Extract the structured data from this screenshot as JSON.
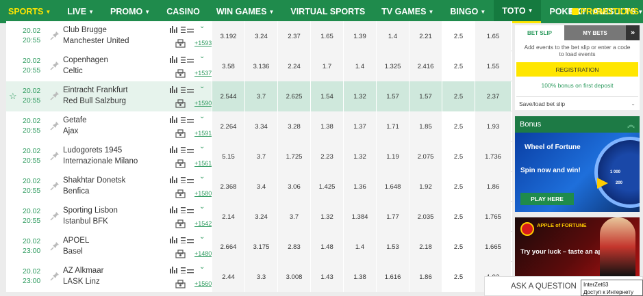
{
  "nav": {
    "items": [
      {
        "label": "SPORTS",
        "caret": true
      },
      {
        "label": "LIVE",
        "caret": true
      },
      {
        "label": "PROMO",
        "caret": true
      },
      {
        "label": "CASINO",
        "caret": false
      },
      {
        "label": "WIN GAMES",
        "caret": true
      },
      {
        "label": "VIRTUAL SPORTS",
        "caret": false
      },
      {
        "label": "TV GAMES",
        "caret": true
      },
      {
        "label": "BINGO",
        "caret": true
      },
      {
        "label": "TOTO",
        "caret": true
      },
      {
        "label": "POKER",
        "caret": false
      },
      {
        "label": "RESULTS",
        "caret": true
      }
    ],
    "extra": "EXTRA",
    "promotions": "PROMOTIONS"
  },
  "events": [
    {
      "date": "20.02",
      "time": "20:55",
      "home": "Club Brugge",
      "away": "Manchester United",
      "more": "+1593",
      "odds": [
        "3.192",
        "3.24",
        "2.37",
        "1.65",
        "1.39",
        "1.4",
        "2.21",
        "2.5",
        "1.65"
      ]
    },
    {
      "date": "20.02",
      "time": "20:55",
      "home": "Copenhagen",
      "away": "Celtic",
      "more": "+1537",
      "odds": [
        "3.58",
        "3.136",
        "2.24",
        "1.7",
        "1.4",
        "1.325",
        "2.416",
        "2.5",
        "1.55"
      ]
    },
    {
      "date": "20.02",
      "time": "20:55",
      "home": "Eintracht Frankfurt",
      "away": "Red Bull Salzburg",
      "more": "+1590",
      "odds": [
        "2.544",
        "3.7",
        "2.625",
        "1.54",
        "1.32",
        "1.57",
        "1.57",
        "2.5",
        "2.37"
      ],
      "highlight": true
    },
    {
      "date": "20.02",
      "time": "20:55",
      "home": "Getafe",
      "away": "Ajax",
      "more": "+1591",
      "odds": [
        "2.264",
        "3.34",
        "3.28",
        "1.38",
        "1.37",
        "1.71",
        "1.85",
        "2.5",
        "1.93"
      ]
    },
    {
      "date": "20.02",
      "time": "20:55",
      "home": "Ludogorets 1945",
      "away": "Internazionale Milano",
      "more": "+1561",
      "odds": [
        "5.15",
        "3.7",
        "1.725",
        "2.23",
        "1.32",
        "1.19",
        "2.075",
        "2.5",
        "1.736"
      ]
    },
    {
      "date": "20.02",
      "time": "20:55",
      "home": "Shakhtar Donetsk",
      "away": "Benfica",
      "more": "+1580",
      "odds": [
        "2.368",
        "3.4",
        "3.06",
        "1.425",
        "1.36",
        "1.648",
        "1.92",
        "2.5",
        "1.86"
      ]
    },
    {
      "date": "20.02",
      "time": "20:55",
      "home": "Sporting Lisbon",
      "away": "Istanbul BFK",
      "more": "+1542",
      "odds": [
        "2.14",
        "3.24",
        "3.7",
        "1.32",
        "1.384",
        "1.77",
        "2.035",
        "2.5",
        "1.765"
      ]
    },
    {
      "date": "20.02",
      "time": "23:00",
      "home": "APOEL",
      "away": "Basel",
      "more": "+1480",
      "odds": [
        "2.664",
        "3.175",
        "2.83",
        "1.48",
        "1.4",
        "1.53",
        "2.18",
        "2.5",
        "1.665"
      ]
    },
    {
      "date": "20.02",
      "time": "23:00",
      "home": "AZ Alkmaar",
      "away": "LASK Linz",
      "more": "+1560",
      "odds": [
        "2.44",
        "3.3",
        "3.008",
        "1.43",
        "1.38",
        "1.616",
        "1.86",
        "2.5",
        "1.92"
      ]
    }
  ],
  "betslip": {
    "tab_active": "BET SLIP",
    "tab_other": "MY BETS",
    "message": "Add events to the bet slip or enter a code to load events",
    "register": "REGISTRATION",
    "bonus": "100% bonus on first deposit",
    "save_load": "Save/load bet slip"
  },
  "bonus_panel": {
    "header": "Bonus",
    "wheel_title": "Wheel of Fortune",
    "wheel_sub": "Spin now and win!",
    "wheel_btn": "PLAY HERE",
    "wheel_values": [
      "1 000",
      "200"
    ],
    "apple_title": "APPLE of FORTUNE",
    "apple_sub": "Try your luck – taste an apple!"
  },
  "ask": "ASK A QUESTION",
  "tooltip": {
    "line1": "InterZet63",
    "line2": "Доступ к Интернету"
  },
  "colors": {
    "brand": "#1f8b4c",
    "accent": "#ffe600",
    "green_text": "#2e9b5f"
  }
}
